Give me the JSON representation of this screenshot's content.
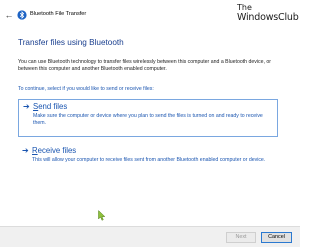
{
  "window": {
    "title": "Bluetooth File Transfer",
    "back_icon": "back-arrow-icon",
    "app_icon": "bluetooth-icon"
  },
  "watermark": {
    "line1": "The",
    "line2": "WindowsClub"
  },
  "main": {
    "heading": "Transfer files using Bluetooth",
    "description": "You can use Bluetooth technology to transfer files wirelessly between this computer and a Bluetooth device, or between this computer and another Bluetooth enabled computer.",
    "prompt": "To continue, select if you would like to send or receive files:"
  },
  "options": [
    {
      "accel": "S",
      "rest": "end files",
      "description": "Make sure the computer or device where you plan to send the files is turned on and ready to receive them.",
      "icon": "arrow-right-icon"
    },
    {
      "accel": "R",
      "rest": "eceive files",
      "description": "This will allow your computer to receive files sent from another Bluetooth enabled computer or device.",
      "icon": "arrow-right-icon"
    }
  ],
  "footer": {
    "next_label": "Next",
    "cancel_label": "Cancel"
  },
  "colors": {
    "heading": "#1a3f8f",
    "link": "#1a55b0",
    "selection_border": "#7aa7e0",
    "footer_bg": "#f0f0f0",
    "cursor": "#8fc23b"
  }
}
